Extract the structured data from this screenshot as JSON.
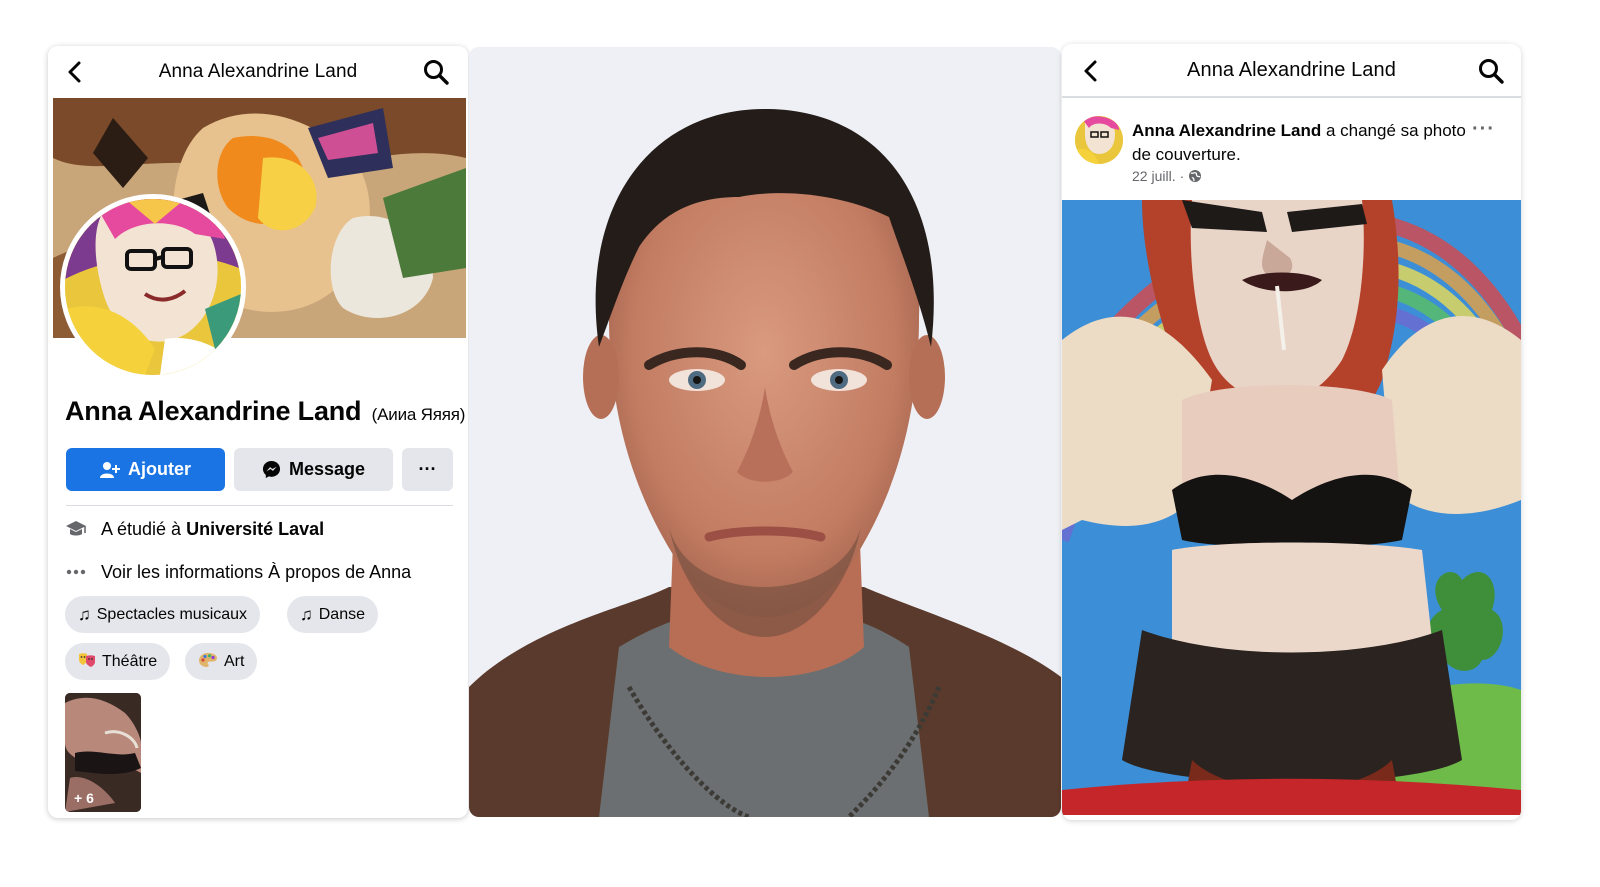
{
  "left_panel": {
    "header_title": "Anna Alexandrine Land",
    "profile_name": "Anna Alexandrine Land",
    "alt_name": "(Аииа Яяяя)",
    "add_label": "Ajouter",
    "message_label": "Message",
    "more_label": "···",
    "study_prefix": "A étudié à",
    "study_place": "Université Laval",
    "about_label": "Voir les informations À propos de Anna",
    "interests": [
      {
        "label": "Spectacles musicaux",
        "icon": "music-note-icon"
      },
      {
        "label": "Danse",
        "icon": "music-note-icon"
      },
      {
        "label": "Théâtre",
        "icon": "theater-masks-icon"
      },
      {
        "label": "Art",
        "icon": "palette-icon"
      }
    ],
    "photo_count": "+ 6"
  },
  "right_panel": {
    "header_title": "Anna Alexandrine Land",
    "post_author": "Anna Alexandrine Land",
    "post_action": "a changé sa photo de couverture.",
    "post_date": "22 juill.",
    "post_separator": "·",
    "more_label": "···"
  },
  "colors": {
    "primary_button": "#1b74e4",
    "secondary_button": "#e4e6eb",
    "meta_text": "#65676b"
  }
}
